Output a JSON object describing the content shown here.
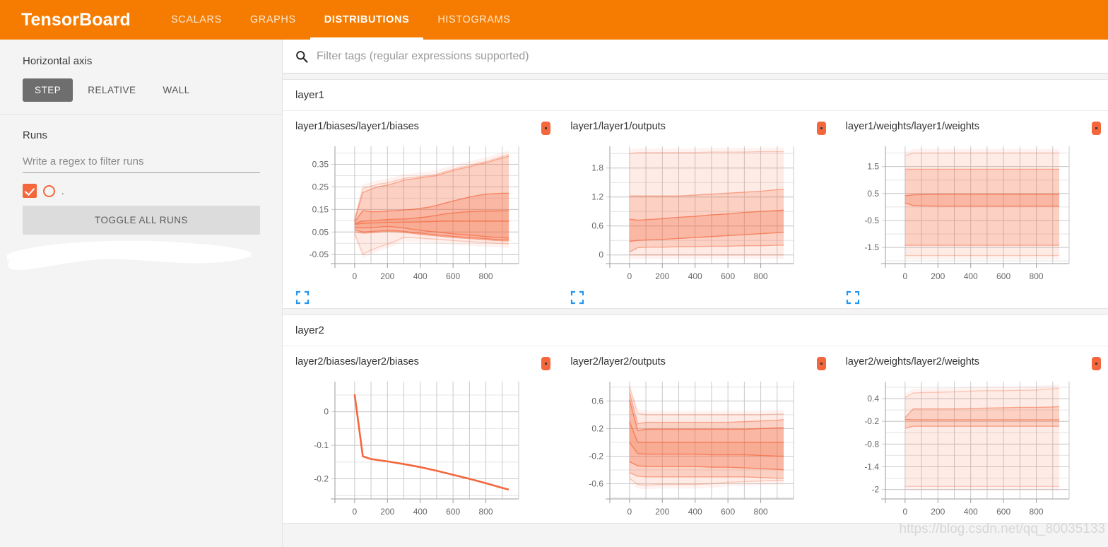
{
  "header": {
    "brand": "TensorBoard",
    "tabs": [
      {
        "label": "SCALARS",
        "active": false
      },
      {
        "label": "GRAPHS",
        "active": false
      },
      {
        "label": "DISTRIBUTIONS",
        "active": true
      },
      {
        "label": "HISTOGRAMS",
        "active": false
      }
    ],
    "accent_color": "#f57c00"
  },
  "sidebar": {
    "horizontal_axis_label": "Horizontal axis",
    "axis_options": [
      {
        "label": "STEP",
        "active": true
      },
      {
        "label": "RELATIVE",
        "active": false
      },
      {
        "label": "WALL",
        "active": false
      }
    ],
    "runs_label": "Runs",
    "runs_filter_placeholder": "Write a regex to filter runs",
    "runs_filter_value": "",
    "run_items": [
      {
        "name": ".",
        "checked": true,
        "color": "#f4673d"
      }
    ],
    "toggle_all_label": "TOGGLE ALL RUNS"
  },
  "filter": {
    "placeholder": "Filter tags (regular expressions supported)",
    "value": "",
    "icon": "search-icon"
  },
  "watermark": "https://blog.csdn.net/qq_80035133",
  "groups": [
    {
      "name": "layer1",
      "charts": [
        0,
        1,
        2
      ]
    },
    {
      "name": "layer2",
      "charts": [
        3,
        4,
        5
      ]
    }
  ],
  "chart_data": [
    {
      "type": "area",
      "title": "layer1/biases/layer1/biases",
      "group": "layer1",
      "xlabel": "",
      "ylabel": "",
      "xlim": [
        -120,
        1000
      ],
      "ylim": [
        -0.09,
        0.43
      ],
      "xticks": [
        0,
        200,
        400,
        600,
        800
      ],
      "yticks": [
        -0.05,
        0.05,
        0.15,
        0.25,
        0.35
      ],
      "x": [
        0,
        50,
        100,
        150,
        200,
        250,
        300,
        350,
        400,
        450,
        500,
        550,
        600,
        650,
        700,
        750,
        800,
        850,
        900,
        940
      ],
      "series": [
        {
          "name": "max",
          "values": [
            0.105,
            0.243,
            0.253,
            0.263,
            0.268,
            0.278,
            0.288,
            0.292,
            0.296,
            0.3,
            0.306,
            0.318,
            0.328,
            0.338,
            0.344,
            0.356,
            0.362,
            0.374,
            0.385,
            0.393
          ]
        },
        {
          "name": "p93",
          "values": [
            0.1,
            0.225,
            0.24,
            0.252,
            0.258,
            0.268,
            0.28,
            0.285,
            0.29,
            0.295,
            0.3,
            0.312,
            0.322,
            0.332,
            0.338,
            0.35,
            0.356,
            0.368,
            0.378,
            0.386
          ]
        },
        {
          "name": "p84",
          "values": [
            0.095,
            0.145,
            0.14,
            0.14,
            0.143,
            0.145,
            0.148,
            0.15,
            0.155,
            0.16,
            0.168,
            0.178,
            0.188,
            0.196,
            0.205,
            0.212,
            0.218,
            0.22,
            0.222,
            0.222
          ]
        },
        {
          "name": "p69",
          "values": [
            0.09,
            0.098,
            0.1,
            0.103,
            0.105,
            0.107,
            0.108,
            0.11,
            0.114,
            0.118,
            0.124,
            0.13,
            0.134,
            0.138,
            0.14,
            0.142,
            0.143,
            0.143,
            0.144,
            0.144
          ]
        },
        {
          "name": "median",
          "values": [
            0.085,
            0.088,
            0.09,
            0.092,
            0.093,
            0.093,
            0.094,
            0.094,
            0.095,
            0.096,
            0.097,
            0.098,
            0.098,
            0.098,
            0.098,
            0.098,
            0.098,
            0.098,
            0.098,
            0.098
          ]
        },
        {
          "name": "p31",
          "values": [
            0.07,
            0.068,
            0.07,
            0.072,
            0.075,
            0.072,
            0.068,
            0.062,
            0.058,
            0.053,
            0.05,
            0.046,
            0.042,
            0.039,
            0.036,
            0.033,
            0.03,
            0.027,
            0.025,
            0.023
          ]
        },
        {
          "name": "p16",
          "values": [
            0.06,
            0.05,
            0.052,
            0.055,
            0.058,
            0.056,
            0.053,
            0.048,
            0.045,
            0.041,
            0.038,
            0.034,
            0.031,
            0.028,
            0.026,
            0.023,
            0.021,
            0.018,
            0.016,
            0.015
          ]
        },
        {
          "name": "p07",
          "values": [
            0.05,
            0.045,
            0.047,
            0.05,
            0.053,
            0.051,
            0.048,
            0.044,
            0.04,
            0.036,
            0.033,
            0.029,
            0.026,
            0.023,
            0.021,
            0.018,
            0.016,
            0.013,
            0.011,
            0.01
          ]
        },
        {
          "name": "min",
          "values": [
            0.045,
            -0.048,
            -0.03,
            -0.016,
            -0.004,
            0.01,
            0.026,
            0.025,
            0.023,
            0.02,
            0.018,
            0.015,
            0.012,
            0.01,
            0.008,
            0.005,
            0.003,
            0.001,
            -0.001,
            -0.003
          ]
        }
      ]
    },
    {
      "type": "area",
      "title": "layer1/layer1/outputs",
      "group": "layer1",
      "xlabel": "",
      "ylabel": "",
      "xlim": [
        -120,
        1000
      ],
      "ylim": [
        -0.18,
        2.25
      ],
      "xticks": [
        0,
        200,
        400,
        600,
        800
      ],
      "yticks": [
        0,
        0.6,
        1.2,
        1.8
      ],
      "x": [
        0,
        50,
        100,
        200,
        300,
        400,
        500,
        600,
        700,
        800,
        900,
        940
      ],
      "series": [
        {
          "name": "max",
          "values": [
            2.1,
            2.12,
            2.12,
            2.12,
            2.12,
            2.12,
            2.13,
            2.13,
            2.13,
            2.14,
            2.14,
            2.14
          ]
        },
        {
          "name": "p93",
          "values": [
            1.22,
            1.22,
            1.22,
            1.22,
            1.22,
            1.24,
            1.26,
            1.28,
            1.3,
            1.32,
            1.35,
            1.36
          ]
        },
        {
          "name": "p84",
          "values": [
            0.74,
            0.72,
            0.73,
            0.75,
            0.78,
            0.8,
            0.83,
            0.85,
            0.88,
            0.9,
            0.92,
            0.93
          ]
        },
        {
          "name": "median",
          "values": [
            0.28,
            0.3,
            0.31,
            0.32,
            0.34,
            0.36,
            0.38,
            0.4,
            0.42,
            0.44,
            0.46,
            0.47
          ]
        },
        {
          "name": "p16",
          "values": [
            0.06,
            0.15,
            0.16,
            0.16,
            0.17,
            0.17,
            0.18,
            0.18,
            0.19,
            0.19,
            0.2,
            0.2
          ]
        },
        {
          "name": "min",
          "values": [
            0.0,
            0.0,
            0.0,
            0.0,
            0.0,
            0.0,
            0.0,
            0.0,
            0.0,
            0.0,
            0.0,
            0.0
          ]
        }
      ]
    },
    {
      "type": "area",
      "title": "layer1/weights/layer1/weights",
      "group": "layer1",
      "xlabel": "",
      "ylabel": "",
      "xlim": [
        -120,
        1000
      ],
      "ylim": [
        -2.1,
        2.25
      ],
      "xticks": [
        0,
        200,
        400,
        600,
        800
      ],
      "yticks": [
        -1.5,
        -0.5,
        0.5,
        1.5
      ],
      "x": [
        0,
        50,
        100,
        200,
        300,
        400,
        500,
        600,
        700,
        800,
        900,
        940
      ],
      "series": [
        {
          "name": "max",
          "values": [
            1.9,
            2.0,
            2.0,
            2.0,
            2.0,
            2.0,
            2.0,
            2.0,
            2.0,
            2.0,
            2.0,
            2.0
          ]
        },
        {
          "name": "p93",
          "values": [
            1.4,
            1.4,
            1.4,
            1.4,
            1.4,
            1.4,
            1.4,
            1.4,
            1.4,
            1.4,
            1.4,
            1.4
          ]
        },
        {
          "name": "p84",
          "values": [
            0.42,
            0.45,
            0.46,
            0.47,
            0.47,
            0.47,
            0.47,
            0.47,
            0.47,
            0.47,
            0.47,
            0.47
          ]
        },
        {
          "name": "median",
          "values": [
            0.15,
            0.05,
            0.04,
            0.03,
            0.03,
            0.03,
            0.03,
            0.03,
            0.03,
            0.03,
            0.03,
            0.03
          ]
        },
        {
          "name": "p16",
          "values": [
            -1.42,
            -1.42,
            -1.42,
            -1.42,
            -1.42,
            -1.42,
            -1.42,
            -1.42,
            -1.42,
            -1.42,
            -1.42,
            -1.42
          ]
        },
        {
          "name": "min",
          "values": [
            -1.8,
            -1.8,
            -1.8,
            -1.8,
            -1.8,
            -1.8,
            -1.8,
            -1.8,
            -1.8,
            -1.8,
            -1.8,
            -1.8
          ]
        }
      ]
    },
    {
      "type": "line",
      "title": "layer2/biases/layer2/biases",
      "group": "layer2",
      "xlabel": "",
      "ylabel": "",
      "xlim": [
        -120,
        1000
      ],
      "ylim": [
        -0.26,
        0.09
      ],
      "xticks": [
        0,
        200,
        400,
        600,
        800
      ],
      "yticks": [
        -0.2,
        -0.1,
        0
      ],
      "x": [
        0,
        50,
        100,
        200,
        300,
        400,
        500,
        600,
        700,
        800,
        900,
        940
      ],
      "series": [
        {
          "name": "value",
          "values": [
            0.052,
            -0.133,
            -0.141,
            -0.148,
            -0.156,
            -0.165,
            -0.176,
            -0.188,
            -0.2,
            -0.213,
            -0.227,
            -0.232
          ]
        }
      ]
    },
    {
      "type": "area",
      "title": "layer2/layer2/outputs",
      "group": "layer2",
      "xlabel": "",
      "ylabel": "",
      "xlim": [
        -120,
        1000
      ],
      "ylim": [
        -0.82,
        0.88
      ],
      "xticks": [
        0,
        200,
        400,
        600,
        800
      ],
      "yticks": [
        -0.6,
        -0.2,
        0.2,
        0.6
      ],
      "x": [
        0,
        50,
        100,
        200,
        300,
        400,
        500,
        600,
        700,
        800,
        900,
        940
      ],
      "series": [
        {
          "name": "max",
          "values": [
            0.8,
            0.42,
            0.4,
            0.4,
            0.4,
            0.4,
            0.4,
            0.4,
            0.4,
            0.4,
            0.41,
            0.41
          ]
        },
        {
          "name": "p93",
          "values": [
            0.72,
            0.27,
            0.29,
            0.29,
            0.29,
            0.29,
            0.29,
            0.29,
            0.3,
            0.31,
            0.32,
            0.33
          ]
        },
        {
          "name": "p84",
          "values": [
            0.62,
            0.17,
            0.19,
            0.19,
            0.19,
            0.19,
            0.19,
            0.19,
            0.19,
            0.2,
            0.21,
            0.21
          ]
        },
        {
          "name": "p69",
          "values": [
            0.3,
            0.0,
            0.0,
            0.0,
            0.0,
            0.0,
            0.0,
            0.0,
            0.0,
            0.0,
            0.0,
            0.0
          ]
        },
        {
          "name": "median",
          "values": [
            0.0,
            -0.16,
            -0.17,
            -0.17,
            -0.17,
            -0.17,
            -0.18,
            -0.18,
            -0.18,
            -0.19,
            -0.2,
            -0.2
          ]
        },
        {
          "name": "p31",
          "values": [
            -0.28,
            -0.34,
            -0.35,
            -0.35,
            -0.35,
            -0.35,
            -0.36,
            -0.36,
            -0.37,
            -0.38,
            -0.39,
            -0.4
          ]
        },
        {
          "name": "p16",
          "values": [
            -0.44,
            -0.49,
            -0.5,
            -0.5,
            -0.5,
            -0.5,
            -0.5,
            -0.5,
            -0.5,
            -0.51,
            -0.52,
            -0.52
          ]
        },
        {
          "name": "min",
          "values": [
            -0.52,
            -0.61,
            -0.62,
            -0.61,
            -0.61,
            -0.61,
            -0.6,
            -0.58,
            -0.57,
            -0.56,
            -0.55,
            -0.55
          ]
        }
      ]
    },
    {
      "type": "area",
      "title": "layer2/weights/layer2/weights",
      "group": "layer2",
      "xlabel": "",
      "ylabel": "",
      "xlim": [
        -120,
        1000
      ],
      "ylim": [
        -2.25,
        0.85
      ],
      "xticks": [
        0,
        200,
        400,
        600,
        800
      ],
      "yticks": [
        -2,
        -1.4,
        -0.8,
        -0.2,
        0.4
      ],
      "x": [
        0,
        50,
        100,
        200,
        300,
        400,
        500,
        600,
        700,
        800,
        900,
        940
      ],
      "series": [
        {
          "name": "max",
          "values": [
            0.43,
            0.55,
            0.56,
            0.57,
            0.58,
            0.6,
            0.61,
            0.61,
            0.62,
            0.63,
            0.66,
            0.67
          ]
        },
        {
          "name": "p84",
          "values": [
            -0.1,
            0.13,
            0.13,
            0.13,
            0.13,
            0.14,
            0.15,
            0.16,
            0.17,
            0.17,
            0.18,
            0.19
          ]
        },
        {
          "name": "median",
          "values": [
            -0.15,
            -0.16,
            -0.16,
            -0.16,
            -0.16,
            -0.16,
            -0.16,
            -0.16,
            -0.16,
            -0.16,
            -0.16,
            -0.16
          ]
        },
        {
          "name": "p16",
          "values": [
            -0.38,
            -0.33,
            -0.33,
            -0.33,
            -0.33,
            -0.33,
            -0.33,
            -0.33,
            -0.33,
            -0.33,
            -0.33,
            -0.33
          ]
        },
        {
          "name": "min",
          "values": [
            -1.92,
            -1.92,
            -1.92,
            -1.92,
            -1.92,
            -1.92,
            -1.92,
            -1.92,
            -1.92,
            -1.92,
            -1.92,
            -1.92
          ]
        }
      ]
    }
  ]
}
